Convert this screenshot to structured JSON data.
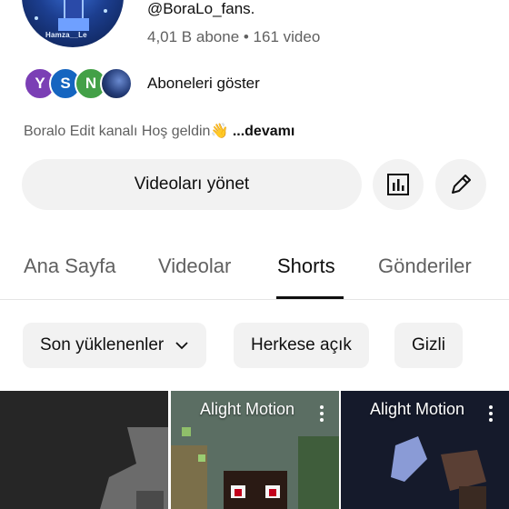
{
  "channel": {
    "handle": "@BoraLo_fans.",
    "meta": "4,01 B abone • 161 video",
    "avatar_tag": "Hamza__Le",
    "subscribers_label": "Aboneleri göster",
    "subscriber_avatars": [
      {
        "initial": "Y",
        "color": "#7b3fb5"
      },
      {
        "initial": "S",
        "color": "#1565c0"
      },
      {
        "initial": "N",
        "color": "#43a047"
      },
      {
        "initial": "",
        "color": ""
      }
    ],
    "description": "Boralo Edit kanalı Hoş geldin👋",
    "description_more": " ...devamı"
  },
  "actions": {
    "manage_label": "Videoları yönet",
    "analytics_icon": "bar-chart-icon",
    "edit_icon": "pencil-icon"
  },
  "tabs": [
    {
      "label": "Ana Sayfa",
      "active": false
    },
    {
      "label": "Videolar",
      "active": false
    },
    {
      "label": "Shorts",
      "active": true
    },
    {
      "label": "Gönderiler",
      "active": false
    }
  ],
  "chips": [
    {
      "label": "Son yüklenenler",
      "icon": "chevron-down-icon"
    },
    {
      "label": "Herkese açık"
    },
    {
      "label": "Gizli"
    }
  ],
  "shorts": [
    {
      "title": ""
    },
    {
      "title": "Alight Motion"
    },
    {
      "title": "Alight Motion"
    }
  ]
}
